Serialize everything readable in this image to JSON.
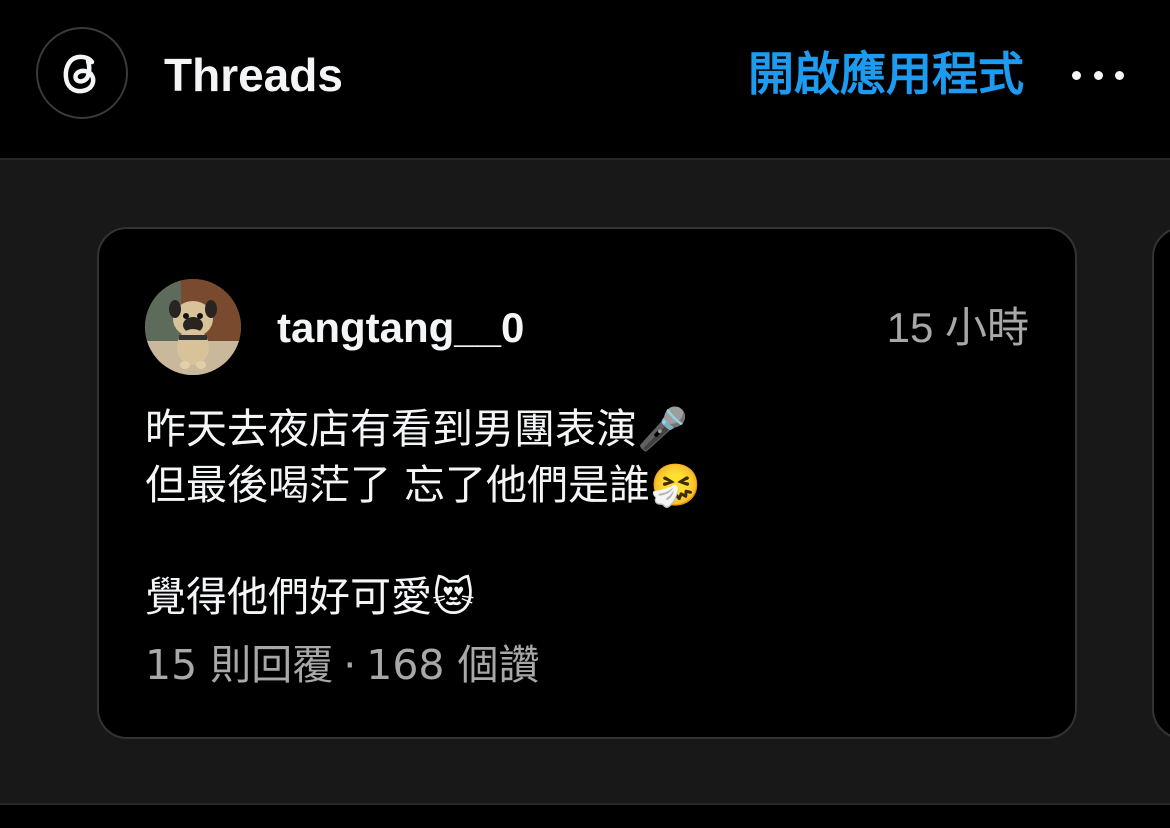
{
  "header": {
    "app_name": "Threads",
    "open_app_label": "開啟應用程式",
    "logo_icon": "threads-logo-icon",
    "more_icon": "more-horizontal-icon"
  },
  "post": {
    "username": "tangtang__0",
    "timestamp": "15 小時",
    "avatar_icon": "pug-dog-avatar",
    "lines": [
      "昨天去夜店有看到男團表演🎤",
      "但最後喝茫了 忘了他們是誰🤧",
      "",
      "覺得他們好可愛😻"
    ],
    "replies": "15 則回覆",
    "separator": "·",
    "likes": "168 個讚"
  },
  "colors": {
    "accent": "#1d9bf0",
    "background": "#000000",
    "feed_background": "#181818",
    "secondary_text": "#a8a8a8",
    "primary_text": "#f3f5f7"
  }
}
